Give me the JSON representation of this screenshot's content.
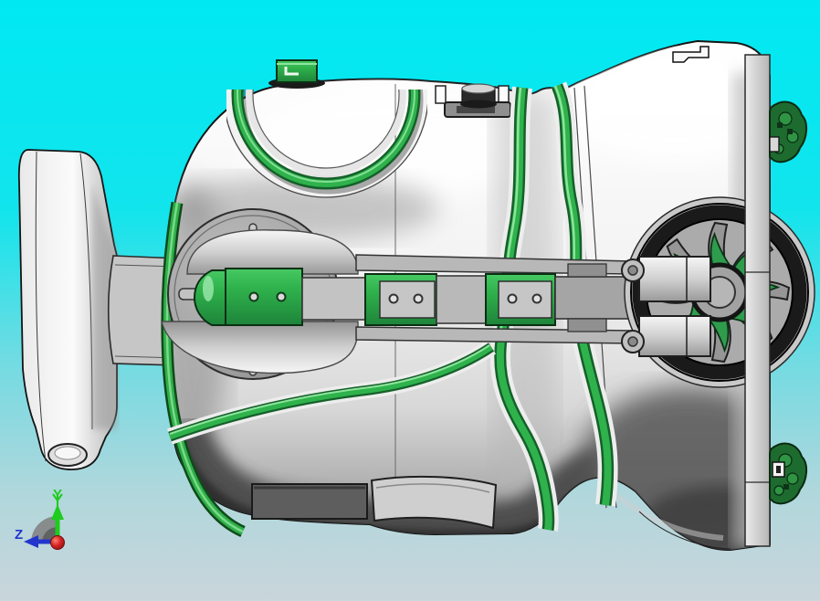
{
  "app": {
    "name": "cad-3d-viewport",
    "scene": "hydraulic pump assembly, side view"
  },
  "axis_triad": {
    "y_label": "Y",
    "z_label": "Z",
    "y_color": "#1ecb1e",
    "z_color": "#2236cc",
    "origin_color": "#d42222",
    "shadow_color": "#7f7f7f"
  },
  "colors": {
    "background_top": "#00e9f3",
    "background_bottom": "#c9d6db",
    "body_light": "#ffffff",
    "body_mid": "#d8d8d8",
    "body_dark": "#4f4f4f",
    "accent_green": "#2fb24c",
    "accent_green_dark": "#15602a",
    "accent_green_light": "#83df96",
    "flange_gray": "#acacac",
    "rim_black": "#1a1a1a",
    "hub_green": "#2e9c4c",
    "outline": "#141414"
  },
  "components": [
    {
      "id": "mount-bracket"
    },
    {
      "id": "pump-housing"
    },
    {
      "id": "green-filler-cap"
    },
    {
      "id": "breather-cap"
    },
    {
      "id": "seal-ring-recess"
    },
    {
      "id": "housing-seal-stripes"
    },
    {
      "id": "shaft-flange"
    },
    {
      "id": "actuator-blocks"
    },
    {
      "id": "flywheel"
    },
    {
      "id": "clamp-blocks"
    },
    {
      "id": "valve-fittings"
    },
    {
      "id": "axis-triad"
    }
  ]
}
